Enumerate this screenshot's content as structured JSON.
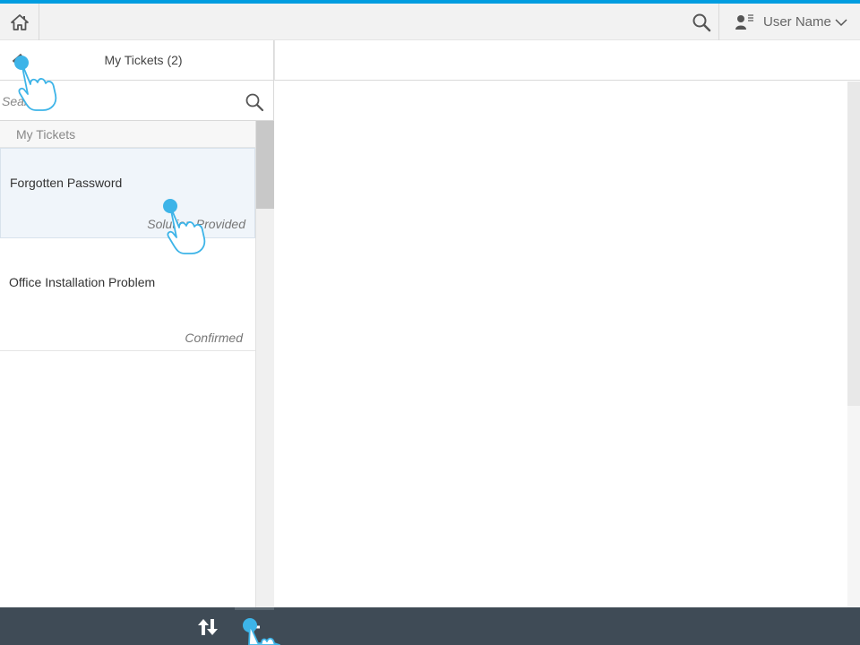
{
  "header": {
    "home_icon": "home-icon",
    "search_icon": "search-icon",
    "user_icon": "user-icon",
    "user_name": "User Name",
    "accent_color": "#009de0"
  },
  "master": {
    "title": "My Tickets (2)",
    "search_placeholder": "Search",
    "group_label": "My Tickets",
    "tickets": [
      {
        "title": "Forgotten Password",
        "status": "Solution Provided",
        "selected": true
      },
      {
        "title": "Office Installation Problem",
        "status": "Confirmed",
        "selected": false
      }
    ]
  },
  "footer": {
    "sort_icon": "sort-icon",
    "add_icon": "add-icon",
    "background": "#3f4b56"
  }
}
